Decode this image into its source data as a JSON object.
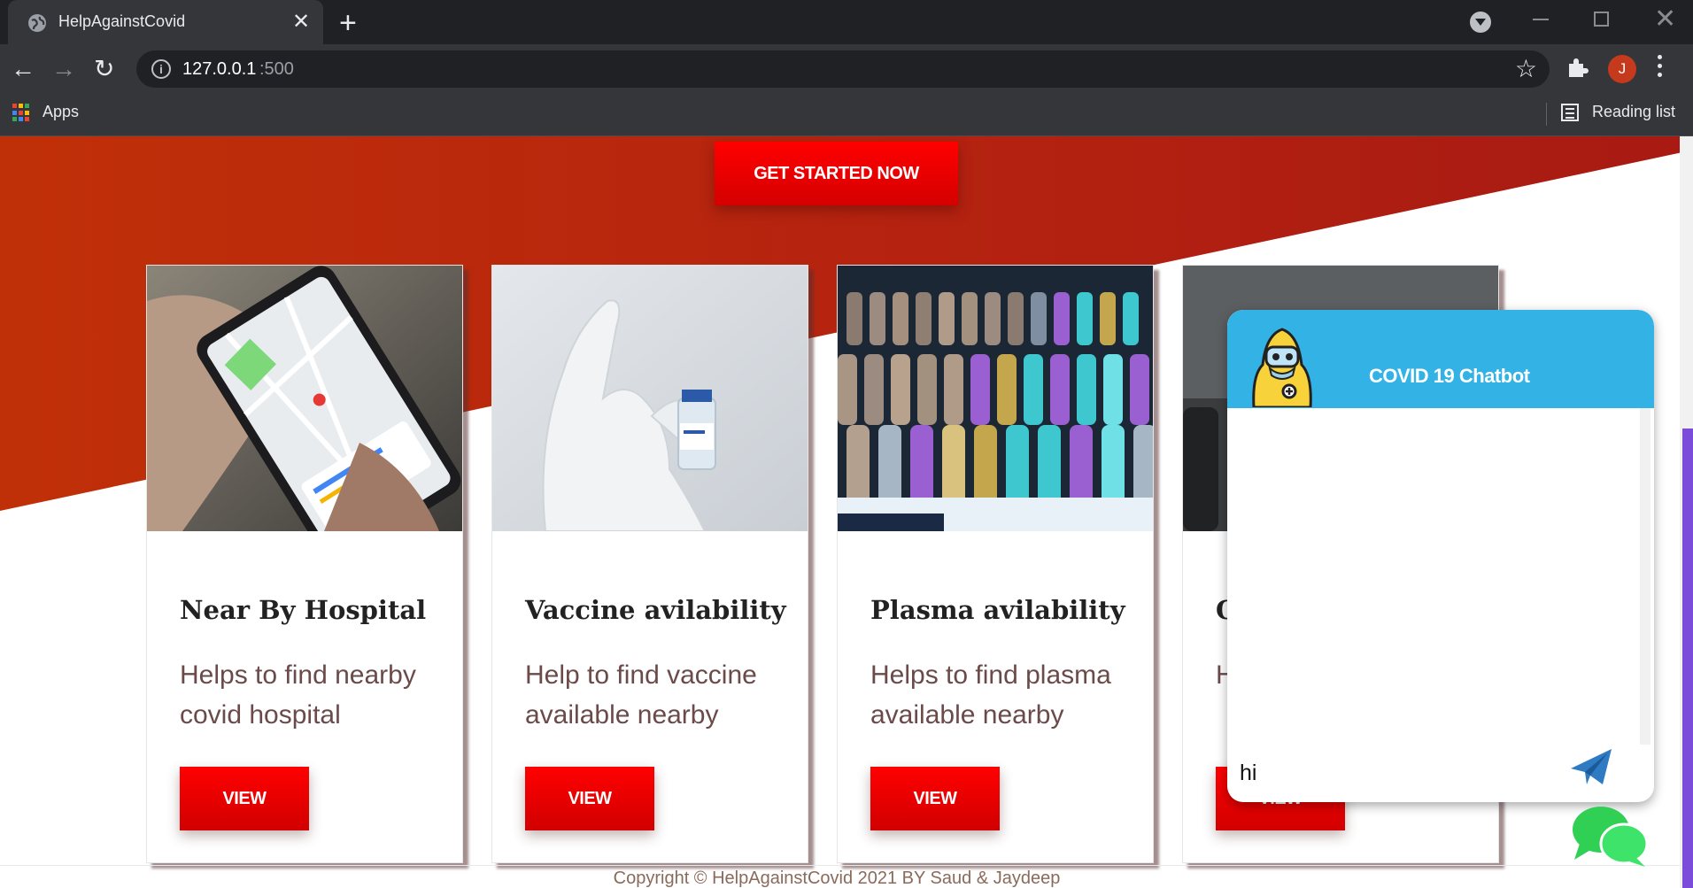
{
  "browser": {
    "tab_title": "HelpAgainstCovid",
    "tab_close": "✕",
    "new_tab": "+",
    "url_host": "127.0.0.1",
    "url_port": ":500",
    "avatar_letter": "J",
    "bookmarks_apps": "Apps",
    "reading_list": "Reading list"
  },
  "hero": {
    "cta_label": "GET STARTED NOW"
  },
  "cards": [
    {
      "title": "Near By Hospital",
      "description": "Helps to find nearby covid hospital",
      "button": "VIEW",
      "image": "phone-map-image"
    },
    {
      "title": "Vaccine avilability",
      "description": "Help to find vaccine available nearby",
      "button": "VIEW",
      "image": "vaccine-vial-image"
    },
    {
      "title": "Plasma avilability",
      "description": "Helps to find plasma available nearby",
      "button": "VIEW",
      "image": "plasma-tubes-image"
    },
    {
      "title": "O",
      "description": "H a",
      "button": "VIEW",
      "image": "oxygen-cylinder-image"
    }
  ],
  "footer": {
    "copyright": "Copyright © HelpAgainstCovid 2021 BY Saud & Jaydeep"
  },
  "chatbot": {
    "title": "COVID 19 Chatbot",
    "input_value": "hi",
    "accent": "#33b2e5"
  },
  "colors": {
    "primary_red": "#e00000",
    "hero_red": "#b52210",
    "scroll_thumb": "#7b4bd9"
  }
}
